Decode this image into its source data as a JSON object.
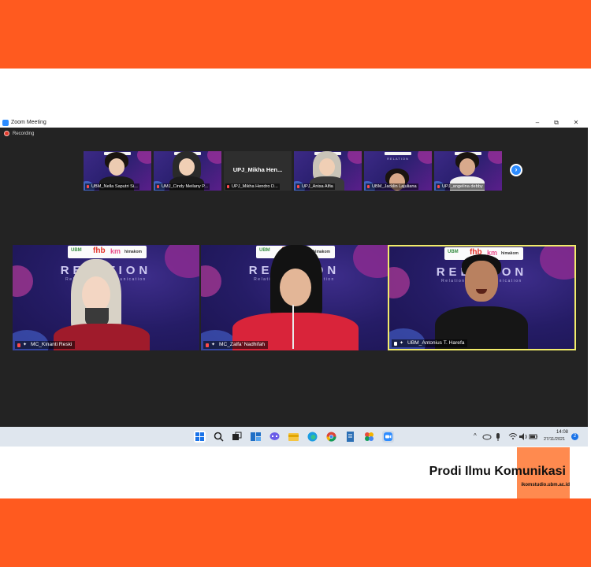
{
  "window": {
    "title": "Zoom Meeting",
    "controls": {
      "minimize": "–",
      "restore": "⧉",
      "close": "✕"
    }
  },
  "recording": {
    "label": "Recording"
  },
  "gallery_strip": [
    {
      "name": "UBM_Nella Saputri Si..."
    },
    {
      "name": "UMJ_Cindy Meilany P..."
    },
    {
      "name": "UPJ_Mikha Hendro D...",
      "display_name": "UPJ_Mikha  Hen..."
    },
    {
      "name": "UPJ_Anisa Alfia"
    },
    {
      "name": "UBM_Jacklin Lajuliana"
    },
    {
      "name": "UPJ_angelina debby"
    }
  ],
  "main_tiles": [
    {
      "name": "MC_Kinanti Reski"
    },
    {
      "name": "MC_Zalfa' Nadhifah"
    },
    {
      "name": "UBM_Antonius T. Harefa",
      "active_speaker": true
    }
  ],
  "virtual_background": {
    "brand": "RELATION",
    "tagline": "Relationship Communication",
    "logos": [
      "fhb",
      "km",
      "himakom"
    ]
  },
  "taskbar": {
    "apps": [
      "windows-start",
      "search",
      "task-view",
      "widgets",
      "chat",
      "file-explorer",
      "edge",
      "chrome",
      "notepad",
      "photos",
      "zoom"
    ],
    "clock": {
      "time": "14:08",
      "date": "27/11/2021"
    },
    "notification_count": "2"
  },
  "footer": {
    "title": "Prodi Ilmu Komunikasi",
    "website": "ikomstudio.ubm.ac.id"
  },
  "colors": {
    "brand_orange": "#ff5a1f",
    "accent_orange": "#ff8a4f",
    "zoom_blue": "#2d8cff",
    "active_speaker_border": "#f2ec6a",
    "meeting_bg": "#232323"
  }
}
